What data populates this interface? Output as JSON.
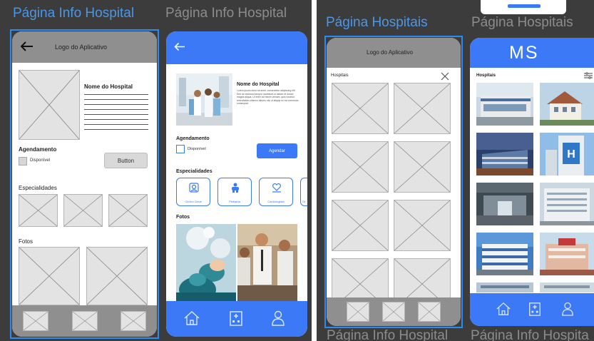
{
  "frames": {
    "info_title_selected": "Página Info Hospital",
    "info_title": "Página Info Hospital",
    "list_title_selected": "Página Hospitais",
    "list_title": "Página Hospitais",
    "bottom_left": "Página Info Hospital",
    "bottom_right": "Página Info Hospita"
  },
  "wire_info": {
    "header_title": "Logo do Aplicativo",
    "hospital_name": "Nome do Hospital",
    "agendamento": "Agendamento",
    "checkbox_label": "Disponível",
    "button_label": "Button",
    "especialidades": "Especialidades",
    "fotos": "Fotos"
  },
  "hifi_info": {
    "hospital_name": "Nome do Hospital",
    "description": "Lorem ipsum dolor sit amet, consectetur adipiscing elit. Sed do eiusmod tempor incididunt ut labore et dolore magna aliqua. Ut enim ad minim veniam, quis nostrud exercitation ullamco laboris nisi ut aliquip ex ea commodo consequat.",
    "agendamento": "Agendamento",
    "checkbox_label": "Disponível",
    "button_label": "Agendar",
    "especialidades": "Especialidades",
    "specialties": [
      "Clínico Geral",
      "Pediatria",
      "Cardiologista",
      "Or"
    ],
    "fotos": "Fotos"
  },
  "wire_list": {
    "header_title": "Logo do Aplicativo",
    "list_title": "Hospitais"
  },
  "hifi_list": {
    "header_title": "MS",
    "list_title": "Hospitais"
  },
  "colors": {
    "accent": "#3b79f6",
    "selection": "#2a8cf0",
    "canvas": "#3c3c3c",
    "wire_gray": "#8f8f8f"
  },
  "icons": [
    "back-arrow-icon",
    "home-icon",
    "hospital-icon",
    "user-icon",
    "close-icon",
    "filter-icon",
    "stethoscope-icon",
    "baby-icon",
    "heart-hand-icon"
  ]
}
